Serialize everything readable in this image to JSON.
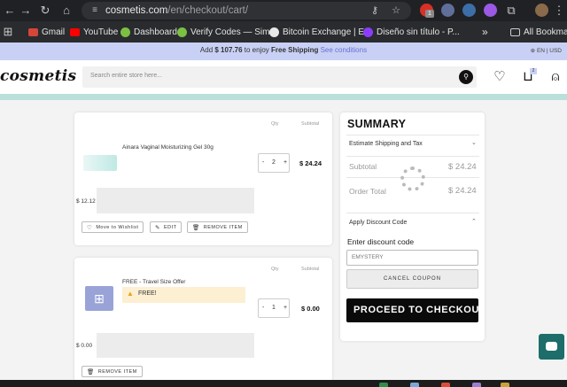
{
  "browser": {
    "url_host": "cosmetis.com",
    "url_path": "/en/checkout/cart/",
    "bookmarks": [
      {
        "label": "Gmail",
        "color": "#d44638"
      },
      {
        "label": "YouTube",
        "color": "#ff0000"
      },
      {
        "label": "Dashboard",
        "color": "#7bc043"
      },
      {
        "label": "Verify Codes — Sim...",
        "color": "#7bc043"
      },
      {
        "label": "Bitcoin Exchange | E...",
        "color": "#e8e8e8"
      },
      {
        "label": "Diseño sin título - P...",
        "color": "#8b3dff"
      }
    ],
    "all_bookmarks_label": "All Bookmarks",
    "ext_badge": "1"
  },
  "promo": {
    "prefix": "Add",
    "amount": "$ 107.76",
    "middle": "to enjoy",
    "highlight": "Free Shipping",
    "link": "See conditions",
    "lang": "EN | USD"
  },
  "header": {
    "logo": "cosmetis",
    "search_placeholder": "Search entire store here...",
    "cart_count": "2"
  },
  "cart": {
    "qty_header": "Qty",
    "subtotal_header": "Subtotal",
    "items": [
      {
        "name": "Ainara Vaginal Moisturizing Gel 30g",
        "qty": "2",
        "subtotal": "$ 24.24",
        "price": "$ 12.12",
        "actions": [
          "Move to Wishlist",
          "EDIT",
          "REMOVE ITEM"
        ]
      },
      {
        "name": "FREE - Travel Size Offer",
        "free_label": "FREE!",
        "qty": "1",
        "subtotal": "$ 0.00",
        "price": "$ 0.00",
        "actions": [
          "REMOVE ITEM"
        ]
      }
    ],
    "minus": "-",
    "plus": "+"
  },
  "summary": {
    "title": "SUMMARY",
    "estimate_label": "Estimate Shipping and Tax",
    "subtotal_label": "Subtotal",
    "subtotal_value": "$ 24.24",
    "order_total_label": "Order Total",
    "order_total_value": "$ 24.24",
    "discount_label": "Apply Discount Code",
    "enter_code_label": "Enter discount code",
    "code_value": "EMYSTERY",
    "cancel_coupon": "CANCEL COUPON",
    "proceed": "PROCEED TO CHECKOUT"
  },
  "colors": {
    "promo_bg": "#c8d0f5",
    "teal": "#b9e0da",
    "chat": "#1d6d6a",
    "free_banner": "#fcefd2",
    "free_icon": "#e8a317"
  }
}
